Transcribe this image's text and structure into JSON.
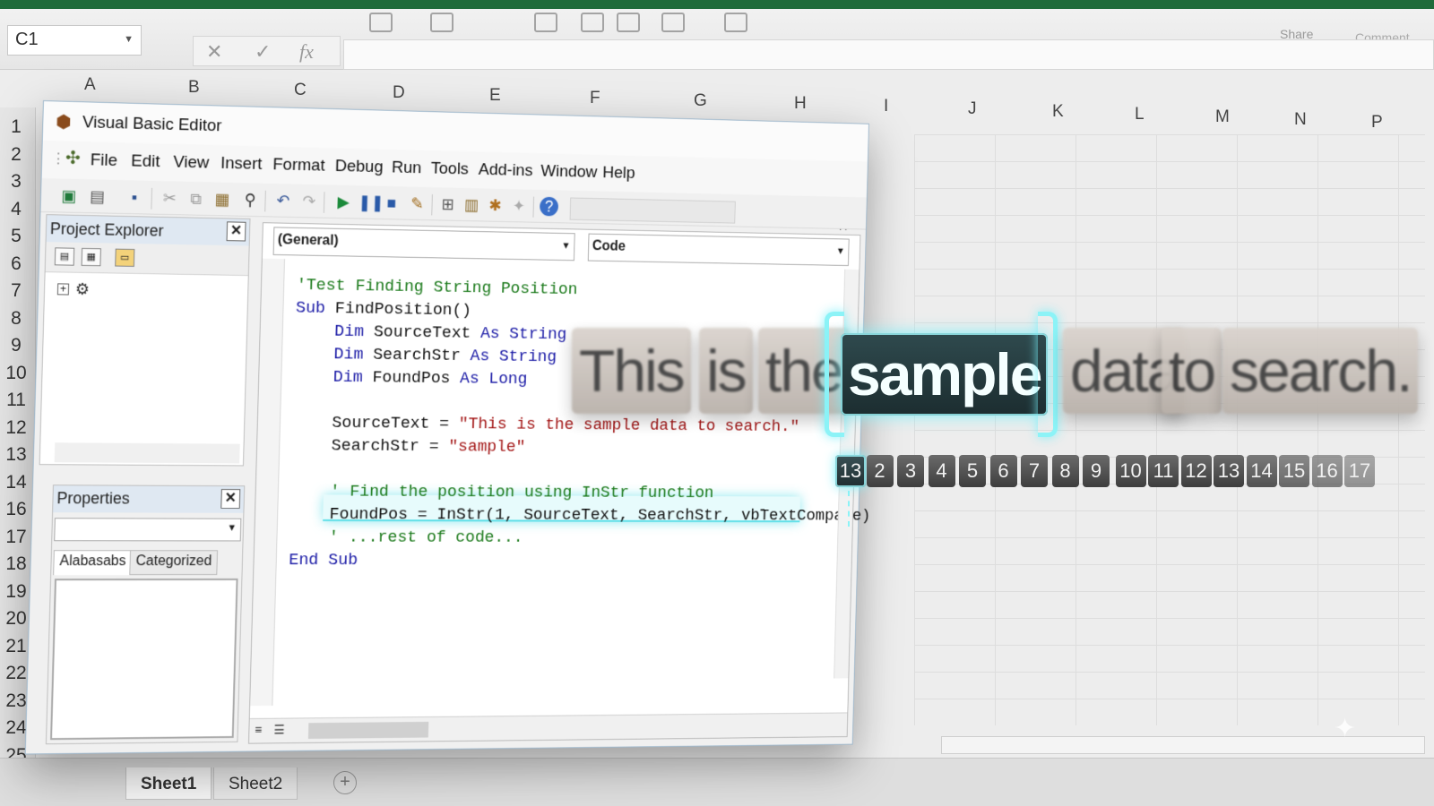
{
  "excel": {
    "namebox": "C1",
    "share_label": "Share",
    "comment_label": "Comment",
    "columns": [
      "A",
      "B",
      "C",
      "D",
      "E",
      "F",
      "G",
      "H",
      "I",
      "J",
      "K",
      "L",
      "M",
      "N",
      "P"
    ],
    "rows": [
      "1",
      "2",
      "3",
      "4",
      "5",
      "6",
      "7",
      "8",
      "9",
      "10",
      "11",
      "12",
      "13",
      "14",
      "16",
      "17",
      "18",
      "19",
      "20",
      "21",
      "22",
      "23",
      "24",
      "25"
    ],
    "sheets": [
      "Sheet1",
      "Sheet2"
    ],
    "add_sheet_symbol": "+",
    "formula_icons": {
      "cancel": "✕",
      "enter": "✓",
      "fx": "fx"
    }
  },
  "vbe": {
    "title": "Visual Basic Editor",
    "window_buttons": {
      "minimize": "—",
      "maximize": "☐",
      "close": "✕"
    },
    "menu": [
      "File",
      "Edit",
      "View",
      "Insert",
      "Format",
      "Debug",
      "Run",
      "Tools",
      "Add-ins",
      "Window",
      "Help"
    ],
    "project_explorer": {
      "title": "Project Explorer"
    },
    "properties": {
      "title": "Properties",
      "tab_alpha": "Alabasabs",
      "tab_categorized": "Categorized"
    },
    "code_window": {
      "object_combo": "(General)",
      "proc_combo": "Code",
      "lines": [
        [
          {
            "t": "'Test Finding String Position",
            "c": "cm"
          }
        ],
        [
          {
            "t": "Sub ",
            "c": "kw"
          },
          {
            "t": "FindPosition()",
            "c": "tx"
          }
        ],
        [
          {
            "t": "    Dim ",
            "c": "kw"
          },
          {
            "t": "SourceText ",
            "c": "tx"
          },
          {
            "t": "As String",
            "c": "kw"
          }
        ],
        [
          {
            "t": "    Dim ",
            "c": "kw"
          },
          {
            "t": "SearchStr ",
            "c": "tx"
          },
          {
            "t": "As String",
            "c": "kw"
          }
        ],
        [
          {
            "t": "    Dim ",
            "c": "kw"
          },
          {
            "t": "FoundPos ",
            "c": "tx"
          },
          {
            "t": "As Long",
            "c": "kw"
          }
        ],
        [
          {
            "t": "",
            "c": "tx"
          }
        ],
        [
          {
            "t": "    SourceText = ",
            "c": "tx"
          },
          {
            "t": "\"This is the sample data to search.\"",
            "c": "st"
          }
        ],
        [
          {
            "t": "    SearchStr = ",
            "c": "tx"
          },
          {
            "t": "\"sample\"",
            "c": "st"
          }
        ],
        [
          {
            "t": "",
            "c": "tx"
          }
        ],
        [
          {
            "t": "    ' Find the position using InStr function",
            "c": "cm"
          }
        ],
        [
          {
            "t": "    FoundPos = InStr(1, SourceText, SearchStr, vbTextCompare)",
            "c": "tx"
          }
        ],
        [
          {
            "t": "    ' ...rest of code...",
            "c": "cm"
          }
        ],
        [
          {
            "t": "End Sub",
            "c": "kw"
          }
        ]
      ]
    }
  },
  "overlay": {
    "words": [
      "This",
      "is",
      "the",
      "sample",
      "data",
      "to",
      "search."
    ],
    "highlight_word": "sample",
    "positions": [
      "13",
      "2",
      "3",
      "4",
      "5",
      "6",
      "7",
      "8",
      "9",
      "10",
      "11",
      "12",
      "13",
      "14",
      "15",
      "16",
      "17"
    ],
    "highlight_position": "13"
  },
  "colors": {
    "accent_glow": "#8cf3f7",
    "keyword": "#1a1aa6",
    "comment": "#1b7a1b",
    "string": "#a31515",
    "excel_green": "#1f6b3a"
  }
}
